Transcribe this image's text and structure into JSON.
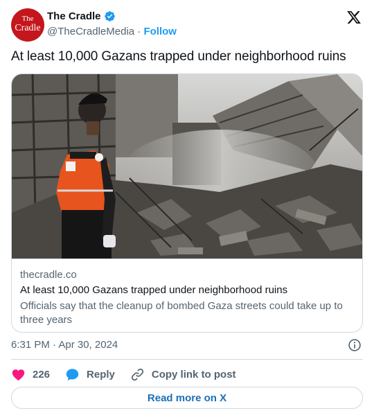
{
  "account": {
    "avatar_text_line1": "The",
    "avatar_text_line2": "Cradle",
    "display_name": "The Cradle",
    "handle": "@TheCradleMedia",
    "separator": "·",
    "follow_label": "Follow",
    "avatar_color": "#c4161c"
  },
  "tweet": {
    "text": "At least 10,000 Gazans trapped under neighborhood ruins",
    "timestamp": "6:31 PM · Apr 30, 2024"
  },
  "link_card": {
    "image_icon": "rubble-photo",
    "domain": "thecradle.co",
    "title": "At least 10,000 Gazans trapped under neighborhood ruins",
    "description": "Officials say that the cleanup of bombed Gaza streets could take up to three years"
  },
  "actions": {
    "like_count": "226",
    "reply_label": "Reply",
    "copy_label": "Copy link to post",
    "like_color": "#f91880",
    "reply_color": "#1d9bf0"
  },
  "footer": {
    "read_more_label": "Read more on X"
  },
  "colors": {
    "accent": "#1d9bf0",
    "muted": "#536471",
    "border": "#cfd9de"
  }
}
